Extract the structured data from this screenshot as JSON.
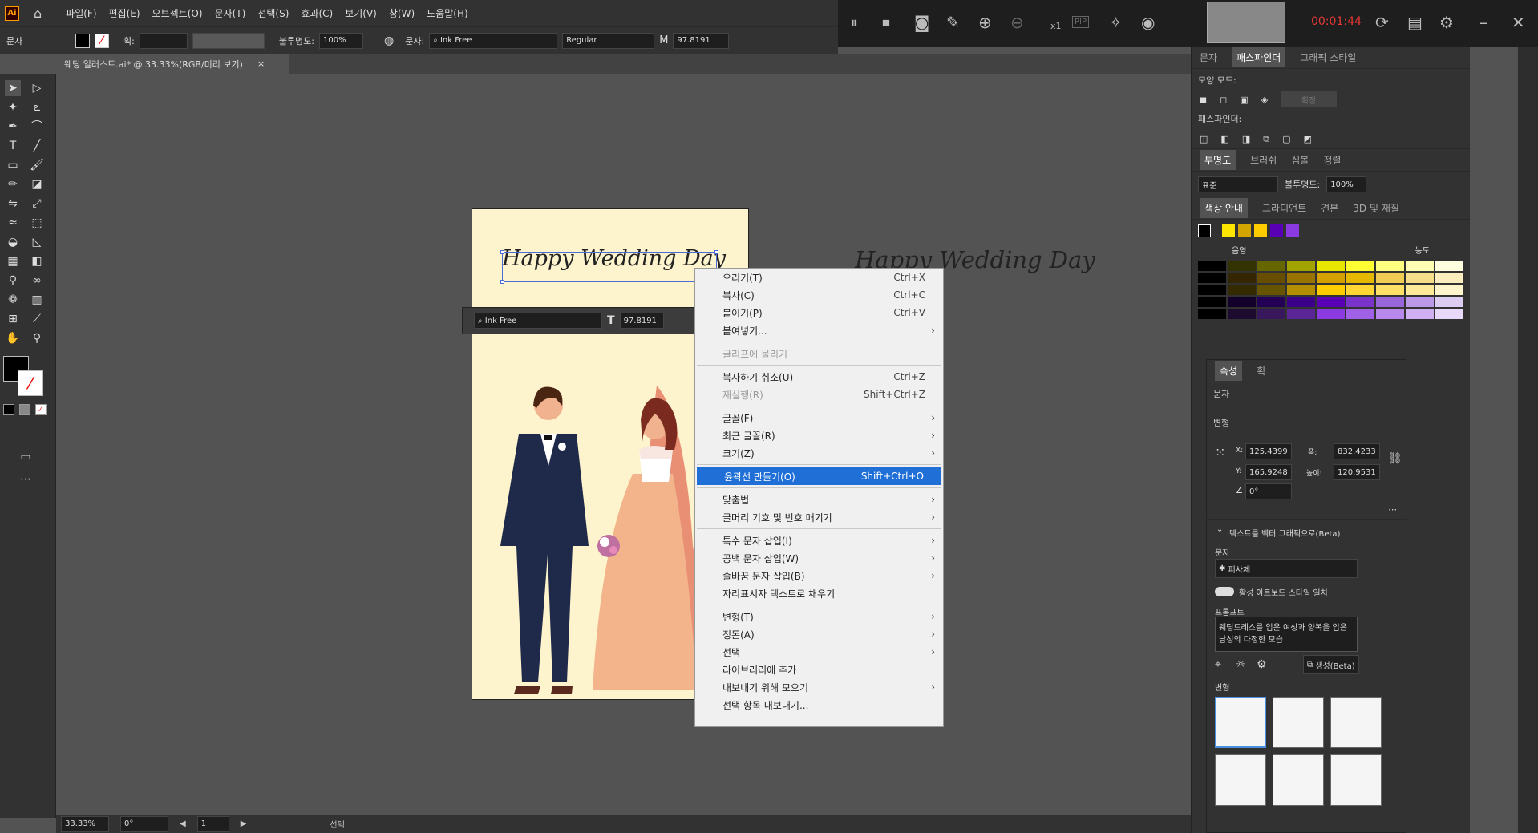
{
  "menubar": {
    "logo": "Ai",
    "menus": [
      "파일(F)",
      "편집(E)",
      "오브젝트(O)",
      "문자(T)",
      "선택(S)",
      "효과(C)",
      "보기(V)",
      "창(W)",
      "도움말(H)"
    ]
  },
  "recorder": {
    "timer": "00:01:44",
    "zoom_label": "x1",
    "pip_label": "PIP"
  },
  "control_bar": {
    "mode_label": "문자",
    "stroke_label": "획:",
    "opacity_label": "불투명도:",
    "opacity_value": "100%",
    "char_label": "문자:",
    "font_name": "Ink Free",
    "font_style": "Regular",
    "font_size": "97.8191"
  },
  "document_tab": {
    "title": "웨딩 일러스트.ai* @ 33.33%(RGB/미리 보기)",
    "close": "×"
  },
  "artwork": {
    "heading_text": "Happy Wedding Day",
    "duplicate_text": "Happy Wedding Day"
  },
  "context_toolbar": {
    "font_name": "Ink Free",
    "font_size": "97.8191"
  },
  "context_menu": {
    "items": [
      {
        "label": "오리기(T)",
        "shortcut": "Ctrl+X"
      },
      {
        "label": "복사(C)",
        "shortcut": "Ctrl+C"
      },
      {
        "label": "붙이기(P)",
        "shortcut": "Ctrl+V"
      },
      {
        "label": "붙여넣기...",
        "arrow": "›"
      },
      {
        "label": "글리프에 물리기",
        "disabled": true
      },
      {
        "label": "복사하기 취소(U)",
        "shortcut": "Ctrl+Z"
      },
      {
        "label": "재실행(R)",
        "shortcut": "Shift+Ctrl+Z",
        "disabled": true
      },
      {
        "label": "글꼴(F)",
        "arrow": "›"
      },
      {
        "label": "최근 글꼴(R)",
        "arrow": "›"
      },
      {
        "label": "크기(Z)",
        "arrow": "›"
      },
      {
        "label": "윤곽선 만들기(O)",
        "shortcut": "Shift+Ctrl+O",
        "highlighted": true
      },
      {
        "label": "맞춤법",
        "arrow": "›"
      },
      {
        "label": "글머리 기호 및 번호 매기기",
        "arrow": "›"
      },
      {
        "label": "특수 문자 삽입(I)",
        "arrow": "›"
      },
      {
        "label": "공백 문자 삽입(W)",
        "arrow": "›"
      },
      {
        "label": "줄바꿈 문자 삽입(B)",
        "arrow": "›"
      },
      {
        "label": "자리표시자 텍스트로 채우기"
      },
      {
        "label": "변형(T)",
        "arrow": "›"
      },
      {
        "label": "정돈(A)",
        "arrow": "›"
      },
      {
        "label": "선택",
        "arrow": "›"
      },
      {
        "label": "라이브러리에 추가"
      },
      {
        "label": "내보내기 위해 모으기",
        "arrow": "›"
      },
      {
        "label": "선택 항목 내보내기..."
      }
    ]
  },
  "right_panel": {
    "tabs1": [
      "문자",
      "패스파인더",
      "그래픽 스타일"
    ],
    "shape_mode_label": "모양 모드:",
    "expand_label": "확장",
    "pathfinder_label": "패스파인더:",
    "tabs2": [
      "투명도",
      "브러쉬",
      "심볼",
      "정렬"
    ],
    "blend_mode": "표준",
    "opacity_label": "불투명도:",
    "opacity_value": "100%",
    "tabs3": [
      "색상 안내",
      "그라디언트",
      "견본",
      "3D 및 재질"
    ],
    "shade_label": "음영",
    "tint_label": "농도"
  },
  "properties_panel": {
    "tabs": [
      "속성",
      "획"
    ],
    "section_text": "문자",
    "transform_label": "변형",
    "x_label": "X:",
    "x_value": "125.4399",
    "y_label": "Y:",
    "y_value": "165.9248",
    "w_label": "폭:",
    "w_value": "832.4233",
    "h_label": "높이:",
    "h_value": "120.9531",
    "angle_value": "0°",
    "vector_section": "텍스트를 벡터 그래픽으로(Beta)",
    "subject_label": "문자",
    "subject_value": "피사체",
    "match_style": "활성 아트보드 스타일 일치",
    "prompt_label": "프롬프트",
    "prompt_text": "웨딩드레스를 입은 여성과 양복을 입은 남성의 다정한 모습",
    "generate_label": "생성(Beta)",
    "variations_label": "변형"
  },
  "statusbar": {
    "zoom": "33.33%",
    "rotate": "0°",
    "artboard": "1",
    "mode": "선택"
  },
  "colors": {
    "accent": "#1f6fd6",
    "selection": "#4a6cd4",
    "artboard_bg": "#fdf3cc"
  }
}
